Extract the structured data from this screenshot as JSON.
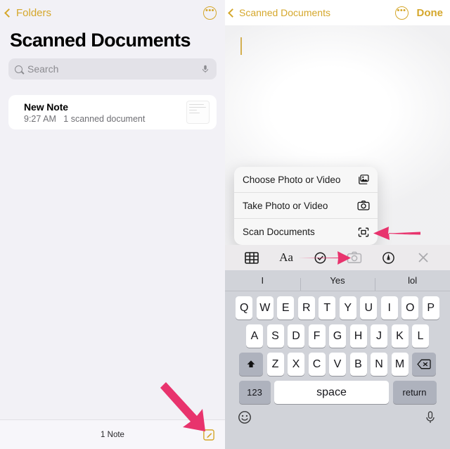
{
  "colors": {
    "accent_yellow": "#d5a72b",
    "arrow_pink": "#e8336d",
    "list_bg": "#f2f1f6",
    "keyboard_bg": "#d1d3d9",
    "toolbar_bg": "#eceaec"
  },
  "left_pane": {
    "back_label": "Folders",
    "more_icon": "ellipsis-circle-icon",
    "title": "Scanned Documents",
    "search": {
      "placeholder": "Search",
      "icon": "search-icon",
      "dictation_icon": "microphone-icon"
    },
    "notes": [
      {
        "title": "New Note",
        "time": "9:27 AM",
        "detail": "1 scanned document",
        "thumbnail": "scanned-note-thumbnail"
      }
    ],
    "footer": {
      "count_label": "1 Note",
      "compose_icon": "compose-note-icon"
    }
  },
  "right_pane": {
    "back_label": "Scanned Documents",
    "more_icon": "ellipsis-circle-icon",
    "done_label": "Done",
    "editor": {
      "body_text": "",
      "caret_visible": true
    },
    "action_sheet": {
      "items": [
        {
          "label": "Choose Photo or Video",
          "icon": "photo-library-icon"
        },
        {
          "label": "Take Photo or Video",
          "icon": "camera-icon"
        },
        {
          "label": "Scan Documents",
          "icon": "document-scanner-icon"
        }
      ]
    },
    "toolbar": {
      "items": [
        {
          "name": "table-icon",
          "label": ""
        },
        {
          "name": "text-format-icon",
          "label": "Aa"
        },
        {
          "name": "checklist-icon",
          "label": ""
        },
        {
          "name": "camera-icon",
          "label": ""
        },
        {
          "name": "markup-pen-icon",
          "label": ""
        },
        {
          "name": "close-icon",
          "label": ""
        }
      ]
    },
    "keyboard": {
      "predictions": [
        "I",
        "Yes",
        "lol"
      ],
      "row1": [
        "Q",
        "W",
        "E",
        "R",
        "T",
        "Y",
        "U",
        "I",
        "O",
        "P"
      ],
      "row2": [
        "A",
        "S",
        "D",
        "F",
        "G",
        "H",
        "J",
        "K",
        "L"
      ],
      "row3": [
        "Z",
        "X",
        "C",
        "V",
        "B",
        "N",
        "M"
      ],
      "shift_icon": "shift-key-icon",
      "delete_icon": "delete-key-icon",
      "numbers_label": "123",
      "space_label": "space",
      "return_label": "return",
      "emoji_icon": "emoji-key-icon",
      "dictation_icon": "microphone-key-icon"
    }
  },
  "annotations": [
    {
      "name": "arrow-to-scan-documents",
      "color": "#e8336d"
    },
    {
      "name": "arrow-to-camera-toolbar",
      "color": "#e8336d"
    },
    {
      "name": "arrow-to-compose-button",
      "color": "#e8336d"
    }
  ]
}
